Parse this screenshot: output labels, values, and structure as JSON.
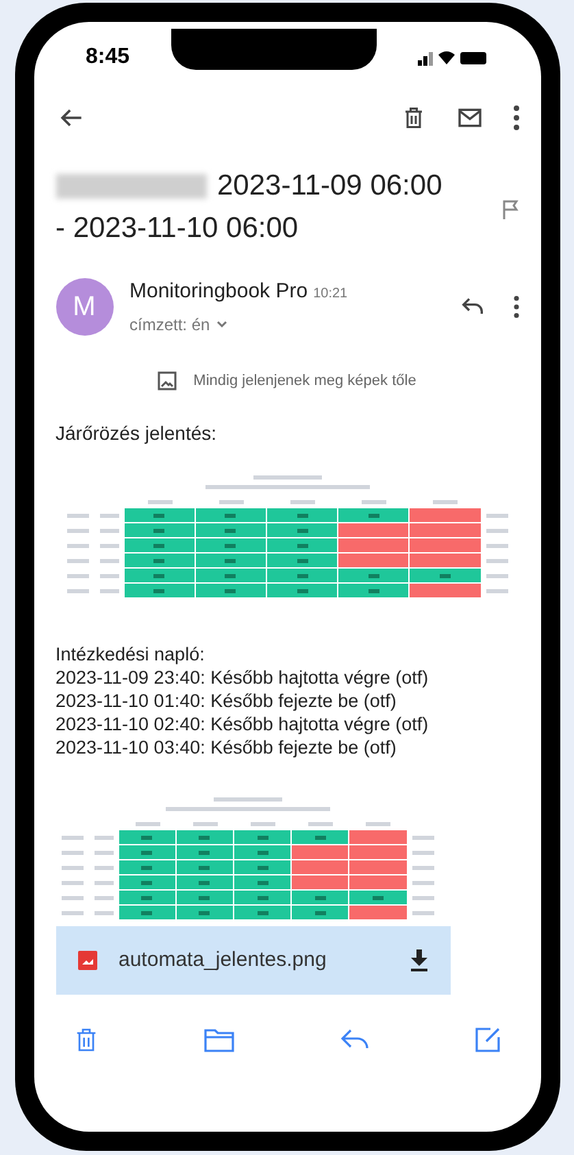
{
  "status_bar": {
    "time": "8:45"
  },
  "subject": {
    "redacted": true,
    "text": "2023-11-09 06:00 - 2023-11-10 06:00"
  },
  "sender": {
    "avatar": "M",
    "name": "Monitoringbook Pro",
    "time": "10:21",
    "recipient": "címzett: én"
  },
  "images_notice": "Mindig jelenjenek meg képek tőle",
  "body_heading": "Járőrözés jelentés:",
  "report_image": {
    "grid": [
      [
        {
          "alert": false
        },
        {
          "alert": false
        },
        {
          "alert": false
        },
        {
          "alert": false
        },
        {
          "alert": true
        }
      ],
      [
        {
          "alert": false
        },
        {
          "alert": false
        },
        {
          "alert": false
        },
        {
          "alert": true
        },
        {
          "alert": true
        }
      ],
      [
        {
          "alert": false
        },
        {
          "alert": false
        },
        {
          "alert": false
        },
        {
          "alert": true
        },
        {
          "alert": true
        }
      ],
      [
        {
          "alert": false
        },
        {
          "alert": false
        },
        {
          "alert": false
        },
        {
          "alert": true
        },
        {
          "alert": true
        }
      ],
      [
        {
          "alert": false
        },
        {
          "alert": false
        },
        {
          "alert": false
        },
        {
          "alert": false
        },
        {
          "alert": false
        }
      ],
      [
        {
          "alert": false
        },
        {
          "alert": false
        },
        {
          "alert": false
        },
        {
          "alert": false
        },
        {
          "alert": true
        }
      ]
    ]
  },
  "log_lines": [
    "Intézkedési napló:",
    "2023-11-09 23:40: Később hajtotta végre (otf)",
    "2023-11-10 01:40: Később fejezte be (otf)",
    "2023-11-10 02:40: Később hajtotta végre (otf)",
    "2023-11-10 03:40: Később fejezte be (otf)"
  ],
  "attachment": {
    "filename": "automata_jelentes.png"
  }
}
